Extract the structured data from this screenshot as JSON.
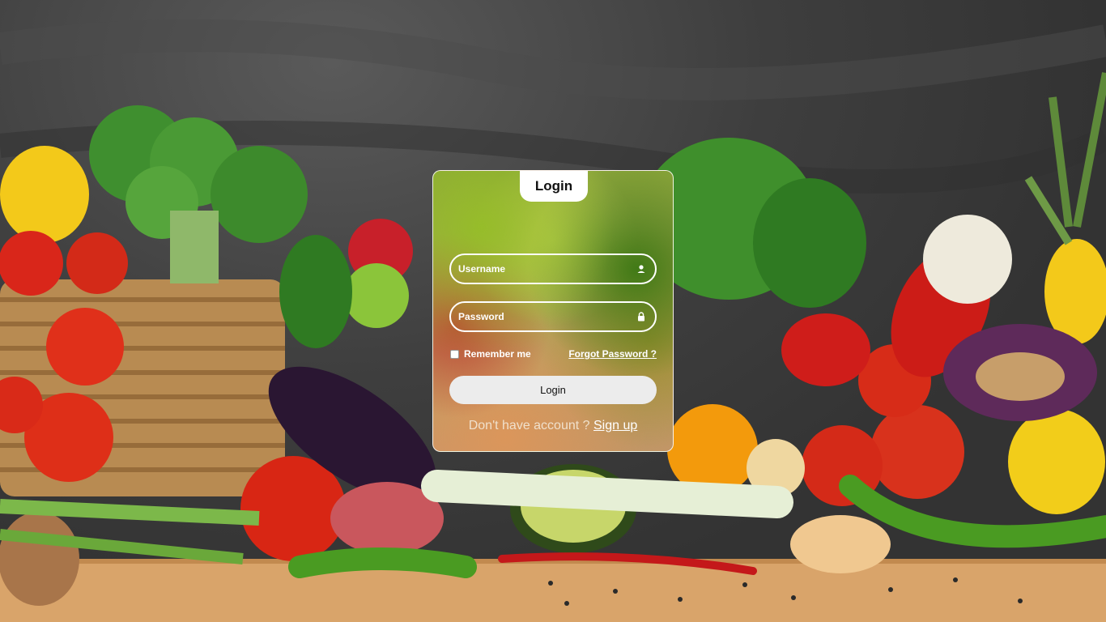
{
  "login_card": {
    "title": "Login",
    "username": {
      "placeholder": "Username",
      "icon": "user-icon"
    },
    "password": {
      "placeholder": "Password",
      "icon": "lock-icon"
    },
    "remember_label": "Remember me",
    "forgot_label": "Forgot Password ?",
    "submit_label": "Login",
    "signup_prompt": "Don't have account ?",
    "signup_link": "Sign up"
  },
  "background": {
    "colors": {
      "wall": "#3a3a3a",
      "table": "#d9a46a"
    }
  }
}
